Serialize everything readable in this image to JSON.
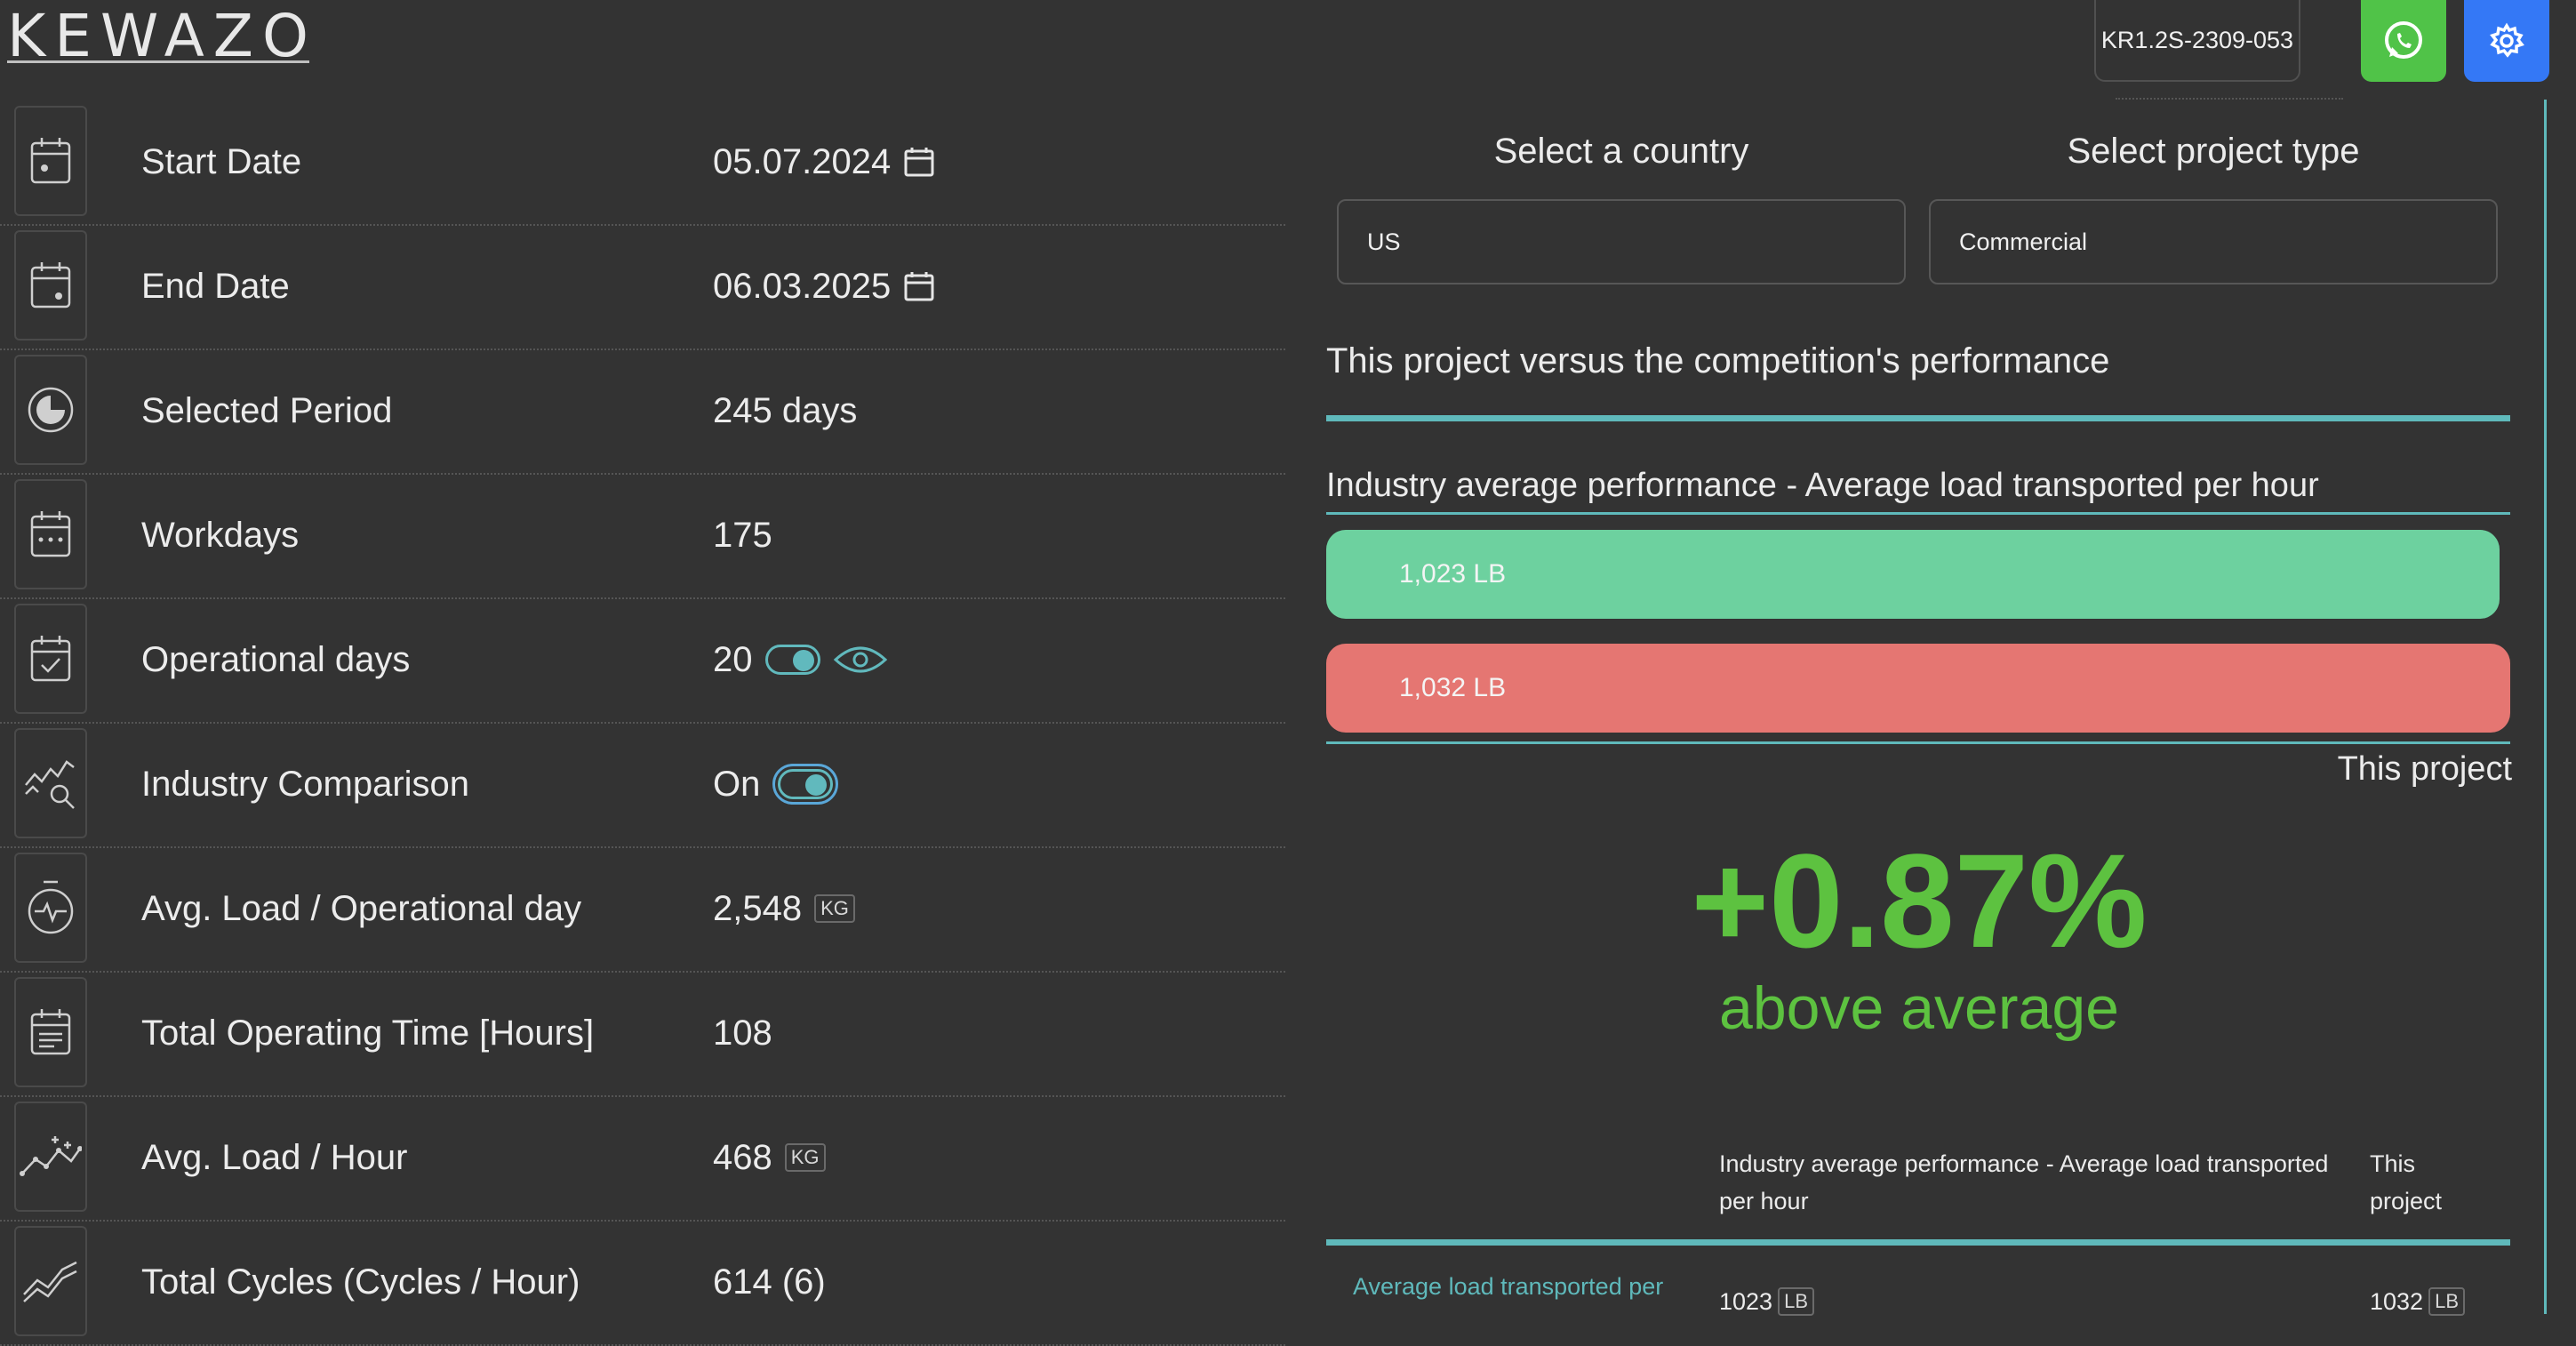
{
  "header": {
    "logo_text": "KEWAZO",
    "device_id": "KR1.2S-2309-053",
    "whatsapp_icon": "whatsapp-icon",
    "settings_icon": "gear-icon"
  },
  "stats": [
    {
      "label": "Start Date",
      "value": "05.07.2024",
      "icon": "calendar-icon"
    },
    {
      "label": "End Date",
      "value": "06.03.2025",
      "icon": "calendar-end-icon"
    },
    {
      "label": "Selected Period",
      "value": "245 days",
      "icon": "period-icon"
    },
    {
      "label": "Workdays",
      "value": "175",
      "icon": "workdays-icon"
    },
    {
      "label": "Operational days",
      "value": "20",
      "icon": "calendar-check-icon"
    },
    {
      "label": "Industry Comparison",
      "value": "On",
      "icon": "chart-search-icon"
    },
    {
      "label": "Avg. Load / Operational day",
      "value": "2,548",
      "unit": "KG",
      "icon": "stopwatch-icon"
    },
    {
      "label": "Total Operating Time [Hours]",
      "value": "108",
      "icon": "document-calendar-icon"
    },
    {
      "label": "Avg. Load / Hour",
      "value": "468",
      "unit": "KG",
      "icon": "trend-sparkle-icon"
    },
    {
      "label": "Total Cycles (Cycles / Hour)",
      "value": "614 (6)",
      "icon": "trend-lines-icon"
    }
  ],
  "comparison": {
    "country_label": "Select a country",
    "country_value": "US",
    "project_type_label": "Select project type",
    "project_type_value": "Commercial",
    "title": "This project versus the competition's performance",
    "industry_title": "Industry average performance - Average load transported per hour",
    "industry_bar_label": "1,023 LB",
    "project_bar_label": "1,032 LB",
    "industry_bar_fraction": 0.991,
    "project_bar_fraction": 1.0,
    "industry_bar_color": "#6dd19f",
    "project_bar_color": "#e57672",
    "this_project_label": "This project",
    "delta": "+0.87%",
    "delta_caption": "above average",
    "accent_color": "#5dc240"
  },
  "table": {
    "col_industry": "Industry average performance - Average load transported per hour",
    "col_project": "This project",
    "row_label": "Average load transported per",
    "row_industry_value": "1023",
    "row_project_value": "1032",
    "unit": "LB"
  }
}
